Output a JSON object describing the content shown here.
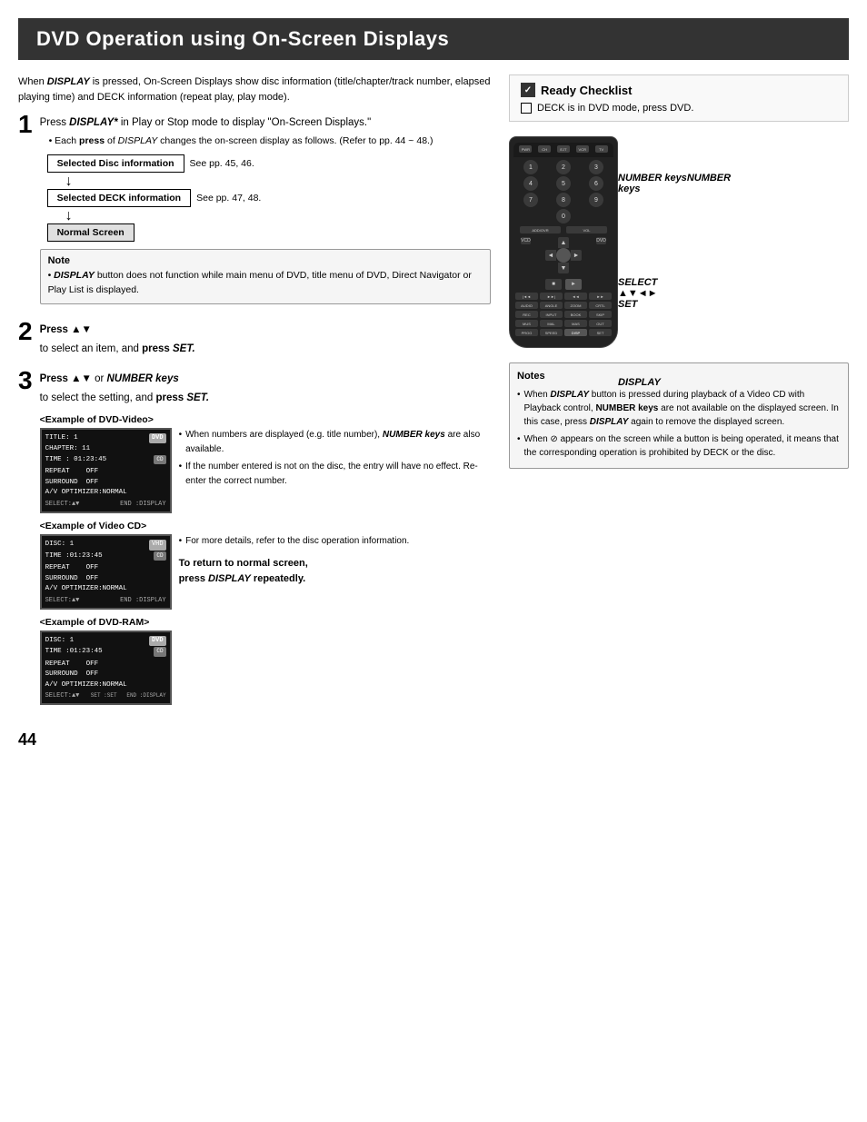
{
  "page": {
    "title": "DVD Operation using On-Screen Displays",
    "page_number": "44"
  },
  "intro": {
    "text": "When DISPLAY is pressed, On-Screen Displays show disc information (title/chapter/track number, elapsed playing time) and DECK information (repeat play, play mode)."
  },
  "step1": {
    "number": "1",
    "text": "Press DISPLAY* in Play or Stop mode to display \"On-Screen Displays.\"",
    "sub": "• Each press of DISPLAY changes the on-screen display as follows. (Refer to pp. 44 ~ 48.)",
    "flow": [
      {
        "label": "Selected Disc information",
        "note": "See pp. 45, 46."
      },
      {
        "label": "Selected DECK information",
        "note": "See pp. 47, 48."
      },
      {
        "label": "Normal Screen",
        "filled": true
      }
    ]
  },
  "note1": {
    "title": "Note",
    "text": "DISPLAY button does not function while main menu of DVD, title menu of DVD, Direct Navigator or Play List is displayed."
  },
  "step2": {
    "number": "2",
    "text": "Press ▲▼",
    "sub": "to select an item, and press SET."
  },
  "step3": {
    "number": "3",
    "text": "Press ▲▼ or NUMBER keys",
    "sub": "to select the setting, and press SET."
  },
  "examples": {
    "dvd_video": {
      "label": "<Example of DVD-Video>",
      "screen_lines": [
        "TITLE: 1",
        "CHAPTER: 11",
        "TIME : 01:23:45",
        "",
        "REPEAT    OFF",
        "SURROUND  OFF",
        "A/V OPTIMIZER:NORMAL"
      ],
      "footer": "SELECT:▲▼  END :DISPLAY"
    },
    "video_cd": {
      "label": "<Example of Video CD>",
      "screen_lines": [
        "DISC: 1",
        "TIME :01:23:45",
        "",
        "REPEAT    OFF",
        "SURROUND  OFF",
        "A/V OPTIMIZER:NORMAL"
      ],
      "footer": "SELECT:▲▼  END :DISPLAY"
    },
    "dvd_ram": {
      "label": "<Example of DVD-RAM>",
      "screen_lines": [
        "DISC: 1",
        "TIME :01:23:45",
        "",
        "REPEAT    OFF",
        "SURROUND  OFF",
        "A/V OPTIMIZER:NORMAL"
      ],
      "footer": "SELECT:▲▼  SET :SET     END :DISPLAY"
    }
  },
  "screen_notes": [
    "When numbers are displayed (e.g. title number), NUMBER keys are also available.",
    "If the number entered is not on the disc, the entry will have no effect. Re-enter the correct number.",
    "For more details, refer to the disc operation information."
  ],
  "return_section": {
    "title": "To return to normal screen,",
    "text": "press DISPLAY repeatedly."
  },
  "ready_checklist": {
    "title": "Ready Checklist",
    "items": [
      "DECK is in DVD mode, press DVD."
    ]
  },
  "remote_labels": {
    "number_keys": "NUMBER\nkeys",
    "select": "SELECT\n▲▼◄►",
    "set": "SET",
    "display": "DISPLAY"
  },
  "notes_bottom": {
    "title": "Notes",
    "items": [
      "When DISPLAY button is pressed during playback of a Video CD with Playback control, NUMBER keys are not available on the displayed screen. In this case, press DISPLAY again to remove the displayed screen.",
      "When ⊘ appears on the screen while a button is being operated, it means that the corresponding operation is prohibited by DECK or the disc."
    ]
  },
  "remote": {
    "top_buttons": [
      "POWER",
      "CH/DISC",
      "EJECT",
      "VCR/TV",
      "TV"
    ],
    "num_rows": [
      [
        "1",
        "2",
        "3"
      ],
      [
        "4",
        "5",
        "6"
      ],
      [
        "7",
        "8",
        "9"
      ],
      [
        "",
        "0",
        ""
      ]
    ],
    "transport": [
      "◄◄",
      "■",
      "►",
      "PLAY"
    ],
    "extra_rows": [
      [
        "SKIP-",
        "SKIP+",
        "◄",
        "►"
      ],
      [
        "AUDIO",
        "ANGLE",
        "ZOOM",
        "CRTL"
      ],
      [
        "ACTIV",
        "",
        "",
        ""
      ],
      [
        "ADD/OVR",
        "VOL",
        "",
        ""
      ],
      [
        "REC",
        "INPUT",
        "BOOK",
        "SKIP"
      ],
      [
        "PROG",
        "SPEED",
        "",
        ""
      ]
    ]
  }
}
